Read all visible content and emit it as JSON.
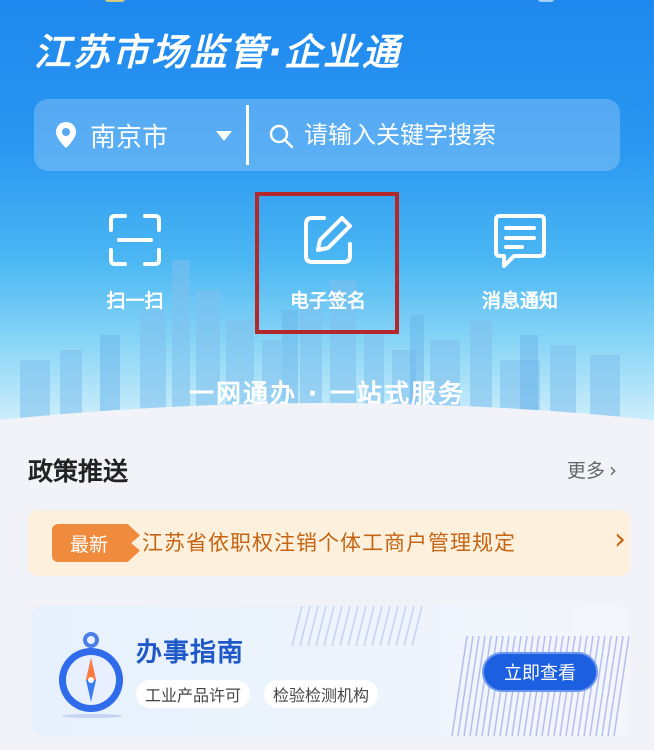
{
  "header": {
    "title": "江苏市场监管·企业通"
  },
  "search": {
    "city": "南京市",
    "placeholder": "请输入关键字搜索"
  },
  "quick_actions": [
    {
      "label": "扫一扫",
      "icon": "scan-icon"
    },
    {
      "label": "电子签名",
      "icon": "pen-sign-icon"
    },
    {
      "label": "消息通知",
      "icon": "message-icon"
    }
  ],
  "slogan": "一网通办 · 一站式服务",
  "policy": {
    "section_title": "政策推送",
    "more_label": "更多",
    "badge": "最新",
    "headline": "江苏省依职权注销个体工商户管理规定"
  },
  "guide": {
    "title": "办事指南",
    "tags": [
      "工业产品许可",
      "检验检测机构"
    ],
    "button_label": "立即查看"
  },
  "colors": {
    "highlight": "#b3282a",
    "primary_blue": "#1c5fe0",
    "badge_orange": "#f08a3c"
  }
}
